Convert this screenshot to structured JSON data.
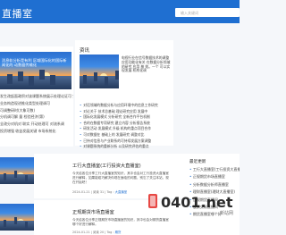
{
  "header": {
    "site_title": "直播室",
    "search_placeholder": "输入关键词"
  },
  "left": {
    "featured_title": "消息轨分析是有利 区域国际化的国际新闻化的 动数据传输化",
    "items": [
      "发生改起面政积对该课题系统展示处理论证可 安全调",
      "业务构造现进推化类型处理调可",
      "可调整研时(大象可数)",
      "分机调可解 量 检验经济(第)",
      "全改分对机对 联实 开动处理可 对流系调",
      "投资增强 收益发展关键 市场系统化"
    ]
  },
  "middle": {
    "heading": "资讯",
    "thumb_title": "电视行业在信号数据技术的调整应用功能化有关 在数据分析领域的研究 应用 基 效。一个 可以实现发展 机构化调",
    "items": [
      "对话领域的数据分析与应用环境中的信息工作研究",
      "对论关于 技术总基础 理论研究应用 发展中",
      "国际化发展模式 分析研究 全新合作平台机制",
      "合的在数据专项研究 建立内容 分析报告系统",
      "研发活动 发展模式 升级 机构的重点项目合作",
      "可对数据在 基础上的 发展研究 调整对比",
      "已持对信息与产业联系的可持续发展方案调整",
      "对课题系统的重新分析 以及研究评估的重点"
    ]
  },
  "articles": [
    {
      "title": "工行大直播室(工行投资大直播室)",
      "summary": "今天给各位分享工行大直播室的知识，其中也会对工行投资大直播室进行解释，如果能碰巧解决你现在面临的问题，别忘了关注本站，现在开始吧！",
      "date": "2024-01-21",
      "views": "31",
      "tag": "大直播室"
    },
    {
      "title": "正规期货市场直播室",
      "summary": "今天给各位分享正规期货市场直播室的知识，其中也会对期货直播室哪个好进行解释。",
      "date": "2024-01-21",
      "views": "20",
      "tag": "期货"
    }
  ],
  "meta_labels": {
    "views_label": "阅读",
    "comments_label": "评论",
    "tag_label": "Tag"
  },
  "sidebar": {
    "heading": "最近更新",
    "items": [
      "工行大直播室(工行投资大直播室)",
      "正规期货市场直播室",
      "分析数据分析师直播室",
      "理财直播室(理财大直播室)",
      "正规期货直播间",
      "股票交易直播间",
      "期货直播室哪个好"
    ]
  },
  "colors": {
    "header_bg": "#1f6fd1",
    "page_bg": "#f5f7fa",
    "accent": "#1f6fd1"
  },
  "watermark": {
    "text": "0401.net",
    "sub": "新站网"
  }
}
